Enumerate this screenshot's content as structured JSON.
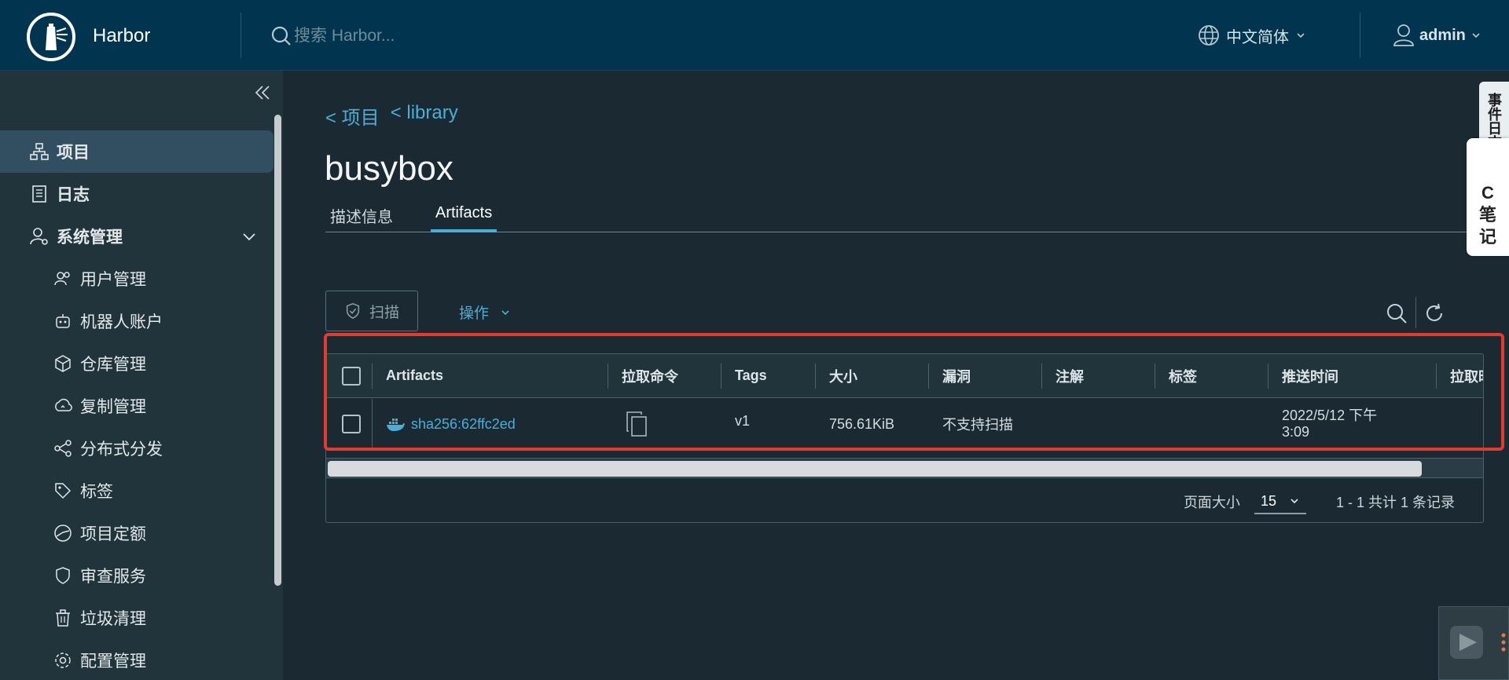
{
  "header": {
    "app_title": "Harbor",
    "search_placeholder": "搜索 Harbor...",
    "language": "中文简体",
    "user": "admin"
  },
  "sidebar": {
    "items": [
      {
        "label": "项目",
        "icon": "project-icon"
      },
      {
        "label": "日志",
        "icon": "log-icon"
      },
      {
        "label": "系统管理",
        "icon": "admin-icon"
      },
      {
        "label": "用户管理",
        "icon": "users-icon"
      },
      {
        "label": "机器人账户",
        "icon": "robot-icon"
      },
      {
        "label": "仓库管理",
        "icon": "registry-icon"
      },
      {
        "label": "复制管理",
        "icon": "replication-icon"
      },
      {
        "label": "分布式分发",
        "icon": "distribution-icon"
      },
      {
        "label": "标签",
        "icon": "tag-icon"
      },
      {
        "label": "项目定额",
        "icon": "quota-icon"
      },
      {
        "label": "审查服务",
        "icon": "shield-icon"
      },
      {
        "label": "垃圾清理",
        "icon": "trash-icon"
      },
      {
        "label": "配置管理",
        "icon": "gear-icon"
      }
    ]
  },
  "breadcrumb": {
    "project": "< 项目",
    "library": "< library"
  },
  "page_title": "busybox",
  "tabs": [
    {
      "label": "描述信息"
    },
    {
      "label": "Artifacts"
    }
  ],
  "toolbar": {
    "scan_label": "扫描",
    "actions_label": "操作"
  },
  "table": {
    "headers": [
      "Artifacts",
      "拉取命令",
      "Tags",
      "大小",
      "漏洞",
      "注解",
      "标签",
      "推送时间",
      "拉取时"
    ],
    "rows": [
      {
        "artifact": "sha256:62ffc2ed",
        "tags": "v1",
        "size": "756.61KiB",
        "vulnerabilities": "不支持扫描",
        "push_time_line1": "2022/5/12 下午",
        "push_time_line2": "3:09"
      }
    ]
  },
  "pagination": {
    "page_size_label": "页面大小",
    "page_size": "15",
    "summary": "1 - 1 共计 1 条记录"
  },
  "floating": {
    "top_label": "事件日志",
    "note_label": "C笔记"
  },
  "colors": {
    "header_bg": "#01344e",
    "sidebar_bg": "#21333b",
    "main_bg": "#1b2a32",
    "accent": "#4aaed9",
    "highlight": "#e53a2f"
  }
}
